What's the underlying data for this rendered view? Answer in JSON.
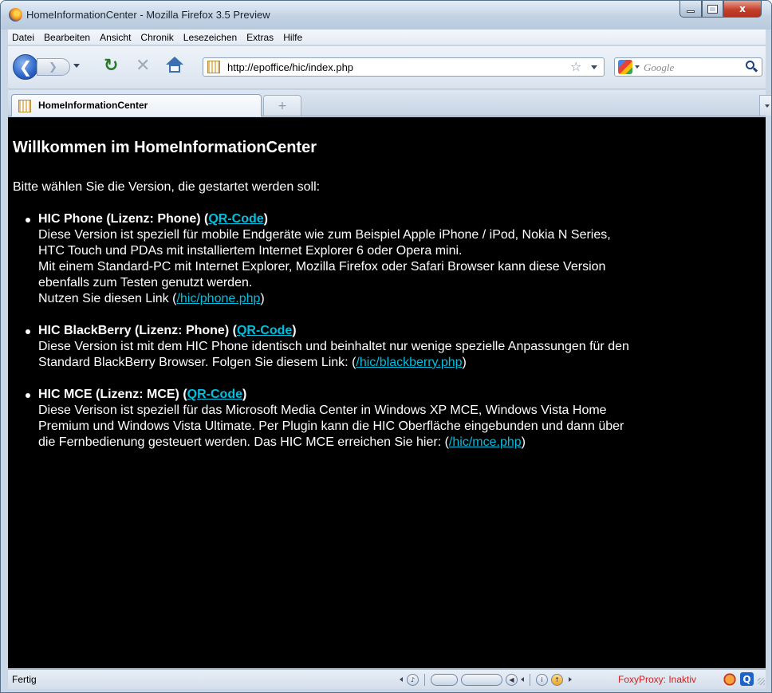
{
  "window": {
    "title": "HomeInformationCenter - Mozilla Firefox 3.5 Preview",
    "controls": {
      "minimize": "–",
      "close": "x"
    }
  },
  "menubar": {
    "items": [
      "Datei",
      "Bearbeiten",
      "Ansicht",
      "Chronik",
      "Lesezeichen",
      "Extras",
      "Hilfe"
    ]
  },
  "navbar": {
    "url": "http://epoffice/hic/index.php",
    "search_placeholder": "Google",
    "icons": [
      "back-icon",
      "forward-icon",
      "reload-icon",
      "stop-icon",
      "home-icon",
      "bookmark-star-icon",
      "search-icon"
    ]
  },
  "tabs": {
    "items": [
      {
        "label": "HomeInformationCenter"
      }
    ],
    "new_tab": "+"
  },
  "page": {
    "title": "Willkommen im HomeInformationCenter",
    "intro": "Bitte wählen Sie die Version, die gestartet werden soll:",
    "versions": [
      {
        "name": "HIC Phone (Lizenz: Phone) (",
        "qr_label": "QR-Code",
        "name_end": ")",
        "lines": [
          "Diese Version ist speziell für mobile Endgeräte wie zum Beispiel Apple iPhone / iPod, Nokia N Series,",
          "HTC Touch und PDAs mit installiertem Internet Explorer 6 oder Opera mini.",
          "Mit einem Standard-PC mit Internet Explorer, Mozilla Firefox oder Safari Browser kann diese Version",
          "ebenfalls zum Testen genutzt werden."
        ],
        "link_prefix": "Nutzen Sie diesen Link (",
        "link": "/hic/phone.php",
        "link_suffix": ")"
      },
      {
        "name": "HIC BlackBerry (Lizenz: Phone) (",
        "qr_label": "QR-Code",
        "name_end": ")",
        "lines": [
          "Diese Version ist mit dem HIC Phone identisch und beinhaltet nur wenige spezielle Anpassungen für den"
        ],
        "link_prefix": "Standard BlackBerry Browser. Folgen Sie diesem Link: (",
        "link": "/hic/blackberry.php",
        "link_suffix": ")"
      },
      {
        "name": "HIC MCE (Lizenz: MCE) (",
        "qr_label": "QR-Code",
        "name_end": ")",
        "lines": [
          "Diese Verison ist speziell für das Microsoft Media Center in Windows XP MCE, Windows Vista Home",
          "Premium und Windows Vista Ultimate. Per Plugin kann die HIC Oberfläche eingebunden und dann über"
        ],
        "link_prefix": "die Fernbedienung gesteuert werden. Das HIC MCE erreichen Sie hier: (",
        "link": "/hic/mce.php",
        "link_suffix": ")"
      }
    ]
  },
  "statusbar": {
    "status": "Fertig",
    "proxy": "FoxyProxy: Inaktiv"
  }
}
